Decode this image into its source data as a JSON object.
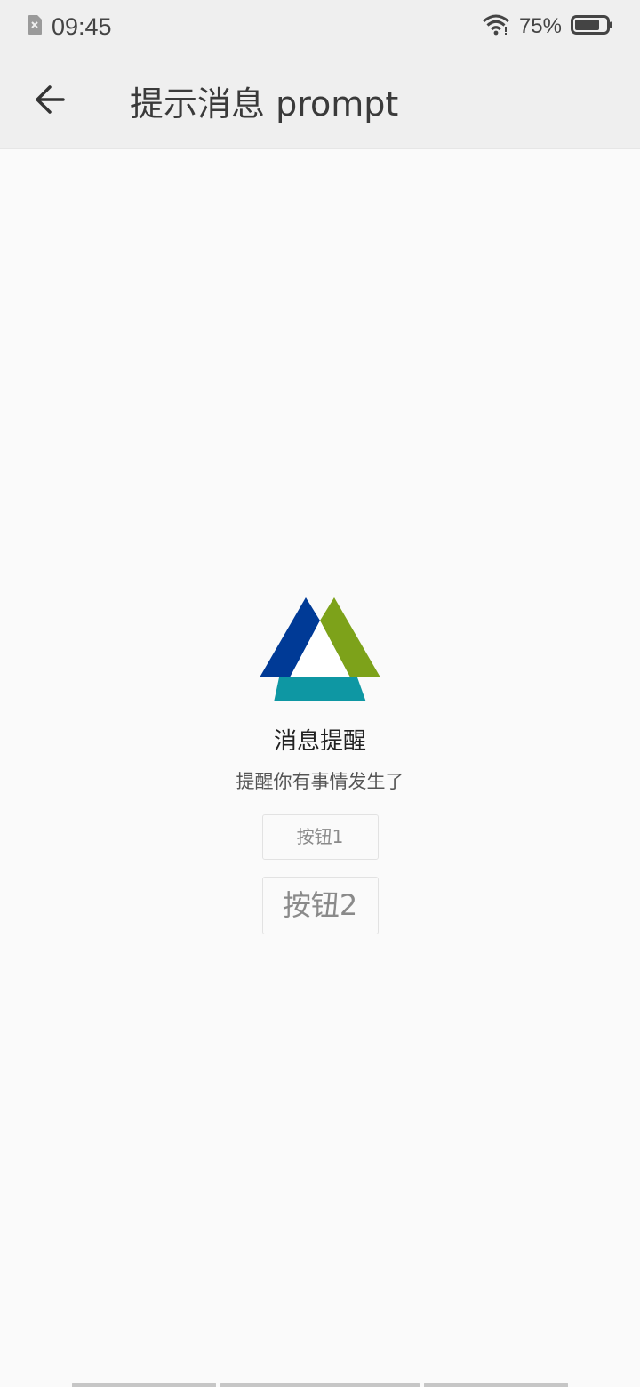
{
  "status_bar": {
    "time": "09:45",
    "battery_percent": "75%",
    "icons": [
      "sim-error-icon",
      "wifi-icon",
      "battery-icon"
    ]
  },
  "app_bar": {
    "back_icon": "arrow-left-icon",
    "title": "提示消息 prompt"
  },
  "prompt": {
    "logo_icon": "tri-color-triangle-logo",
    "title": "消息提醒",
    "message": "提醒你有事情发生了",
    "buttons": [
      {
        "label": "按钮1"
      },
      {
        "label": "按钮2"
      }
    ]
  },
  "colors": {
    "logo_blue": "#003a96",
    "logo_green": "#7da21a",
    "logo_teal": "#0e97a3",
    "header_bg": "#efefef",
    "page_bg": "#fafafa"
  }
}
